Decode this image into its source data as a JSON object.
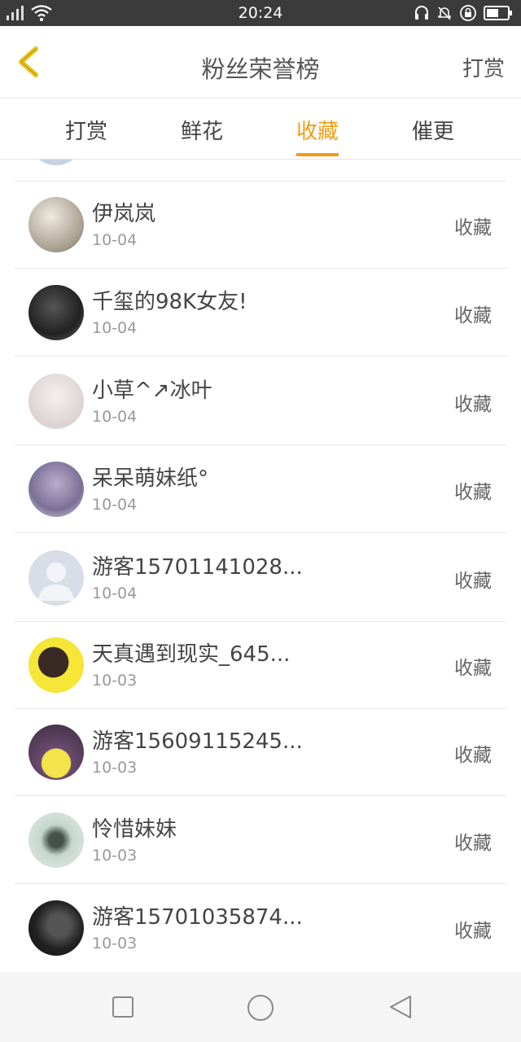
{
  "status_bar": {
    "time": "20:24"
  },
  "header": {
    "title": "粉丝荣誉榜",
    "right_label": "打赏"
  },
  "tabs": [
    {
      "label": "打赏",
      "active": false
    },
    {
      "label": "鲜花",
      "active": false
    },
    {
      "label": "收藏",
      "active": true
    },
    {
      "label": "催更",
      "active": false
    }
  ],
  "rows": [
    {
      "name": "伊岚岚",
      "date": "10-04",
      "action": "收藏",
      "avatar": "photo-avatar"
    },
    {
      "name": "千玺的98K女友!",
      "date": "10-04",
      "action": "收藏",
      "avatar": "photo-avatar"
    },
    {
      "name": "小草^↗冰叶",
      "date": "10-04",
      "action": "收藏",
      "avatar": "photo-avatar"
    },
    {
      "name": "呆呆萌妹纸°",
      "date": "10-04",
      "action": "收藏",
      "avatar": "photo-avatar"
    },
    {
      "name": "游客15701141028...",
      "date": "10-04",
      "action": "收藏",
      "avatar": "default-avatar"
    },
    {
      "name": "天真遇到现实_645...",
      "date": "10-03",
      "action": "收藏",
      "avatar": "photo-avatar"
    },
    {
      "name": "游客15609115245...",
      "date": "10-03",
      "action": "收藏",
      "avatar": "photo-avatar"
    },
    {
      "name": "怜惜妹妹",
      "date": "10-03",
      "action": "收藏",
      "avatar": "photo-avatar"
    },
    {
      "name": "游客15701035874...",
      "date": "10-03",
      "action": "收藏",
      "avatar": "photo-avatar"
    }
  ],
  "colors": {
    "accent": "#f39c12",
    "status_bar": "#3b3b3b",
    "back_arrow": "#e8c21a"
  },
  "nav_bar": {
    "icons": [
      "recent-apps-icon",
      "home-icon",
      "back-icon"
    ]
  }
}
